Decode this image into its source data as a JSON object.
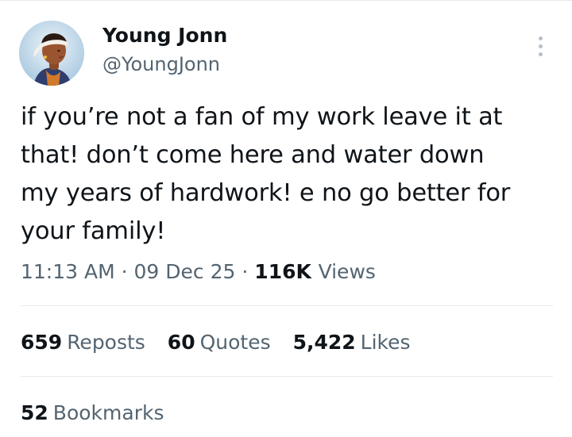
{
  "author": {
    "display_name": "Young Jonn",
    "handle": "@YoungJonn",
    "avatar_icon": "profile-portrait"
  },
  "menu": {
    "more_icon": "more-vertical-icon"
  },
  "tweet": {
    "lines": [
      "if you’re not a fan of my work leave it at",
      "that! don’t come here and water down",
      "my years of hardwork! e no go better for",
      "your family!"
    ]
  },
  "meta": {
    "time": "11:13 AM",
    "separator": "·",
    "date": "09 Dec 25",
    "views_count": "116K",
    "views_label": "Views"
  },
  "stats": {
    "reposts": {
      "count": "659",
      "label": "Reposts"
    },
    "quotes": {
      "count": "60",
      "label": "Quotes"
    },
    "likes": {
      "count": "5,422",
      "label": "Likes"
    },
    "bookmarks": {
      "count": "52",
      "label": "Bookmarks"
    }
  },
  "colors": {
    "text_primary": "#0f1419",
    "text_secondary": "#536471",
    "divider": "#e6e9ec",
    "avatar_bg": "#dfe9f1"
  }
}
